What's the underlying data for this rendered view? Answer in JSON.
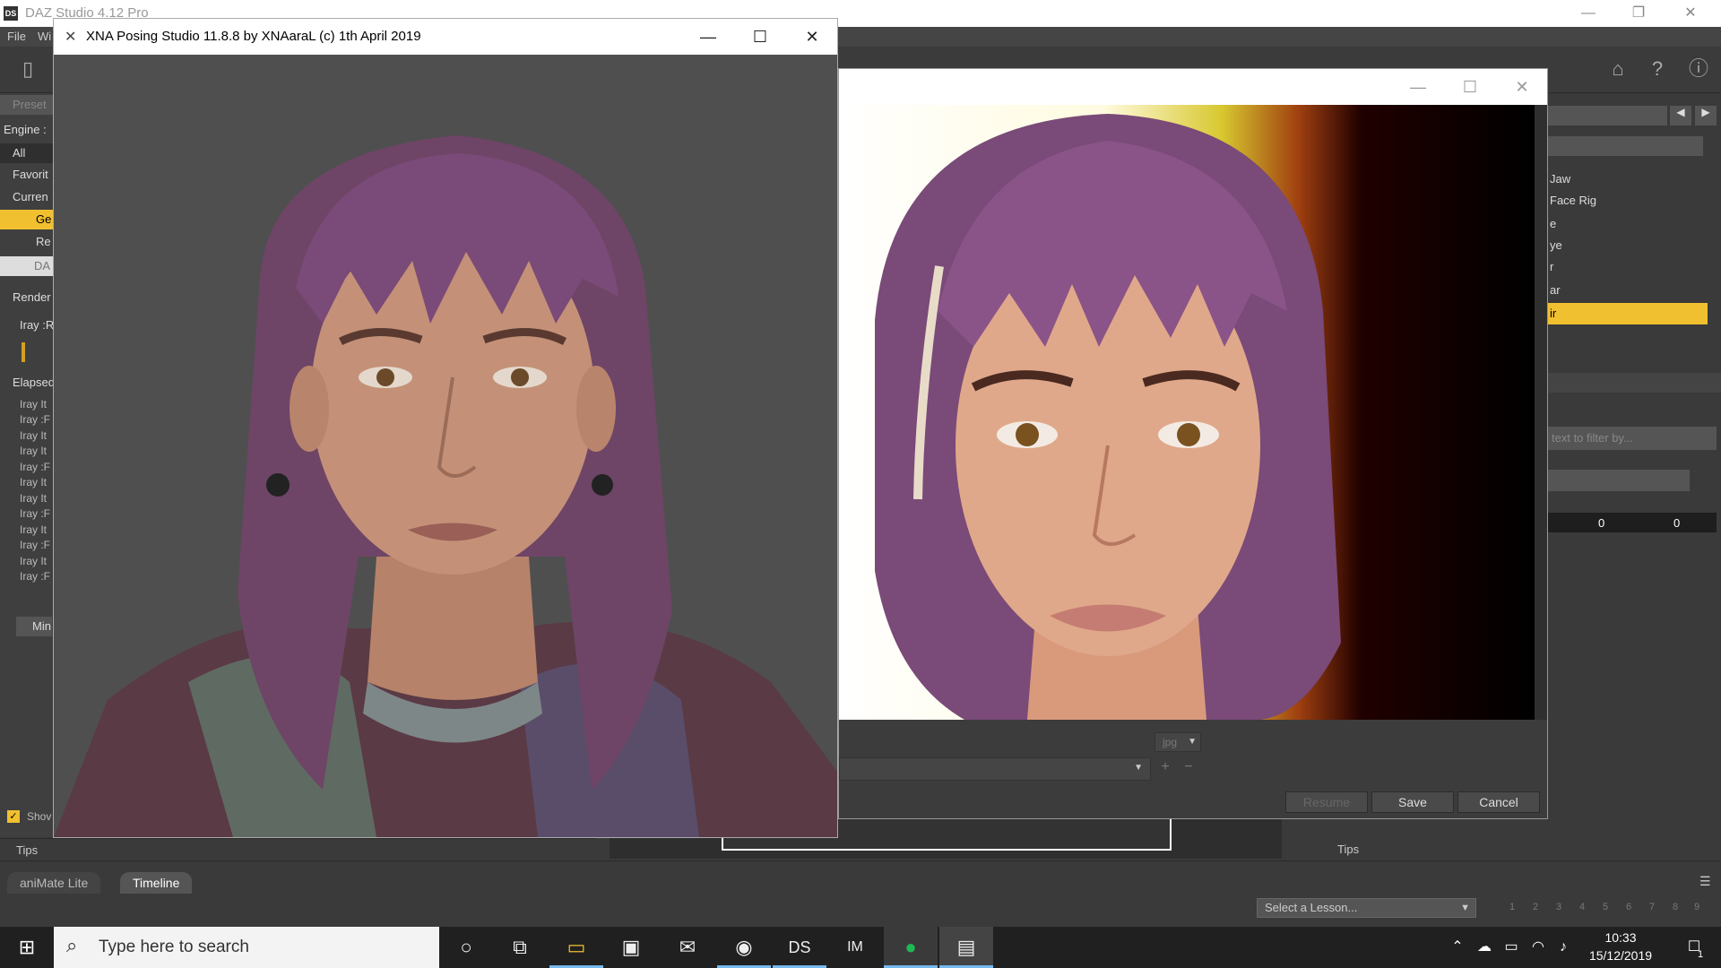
{
  "daz": {
    "title": "DAZ Studio 4.12 Pro",
    "logo_text": "DS",
    "menu": [
      "File",
      "Wi"
    ],
    "left_pane": {
      "presets": "Preset",
      "engine": "Engine :",
      "all": "All",
      "favorite": "Favorit",
      "current": "Curren",
      "ge": "Ge",
      "re": "Re",
      "da": "DA",
      "render": "Render",
      "iray_r": "Iray :R",
      "elapsed": "Elapsed",
      "iray_lines": [
        "Iray It",
        "Iray :F",
        "Iray It",
        "Iray It",
        "Iray :F",
        "Iray It",
        "Iray It",
        "Iray :F",
        "Iray It",
        "Iray :F",
        "Iray It",
        "Iray :F"
      ],
      "min": "Min",
      "show": "Shov"
    },
    "right_pane": {
      "items": [
        "Jaw",
        "Face Rig",
        "e",
        "ye",
        "r",
        "ar",
        "ir"
      ],
      "filter_placeholder": "text to filter by...",
      "val_a": "0",
      "val_b": "0"
    },
    "bottom": {
      "tips_left": "Tips",
      "tips_right": "Tips",
      "tab_animate": "aniMate Lite",
      "tab_timeline": "Timeline",
      "lesson": "Select a Lesson...",
      "lesson_pages": [
        "1",
        "2",
        "3",
        "4",
        "5",
        "6",
        "7",
        "8",
        "9"
      ]
    }
  },
  "xna": {
    "title": "XNA Posing Studio 11.8.8 by XNAaraL (c) 1th April 2019",
    "minimize": "—",
    "maximize": "☐",
    "close": "✕"
  },
  "render_window": {
    "minimize": "—",
    "maximize": "☐",
    "close": "✕",
    "format": "jpg",
    "resume": "Resume",
    "save": "Save",
    "cancel": "Cancel"
  },
  "taskbar": {
    "search_placeholder": "Type here to search",
    "time": "10:33",
    "date": "15/12/2019",
    "ds_label": "DS",
    "im_label": "IM",
    "notification_count": "1"
  },
  "colors": {
    "accent_yellow": "#f0c030",
    "taskbar_active": "#76b9ed",
    "hair_purple": "#7a4a78"
  }
}
